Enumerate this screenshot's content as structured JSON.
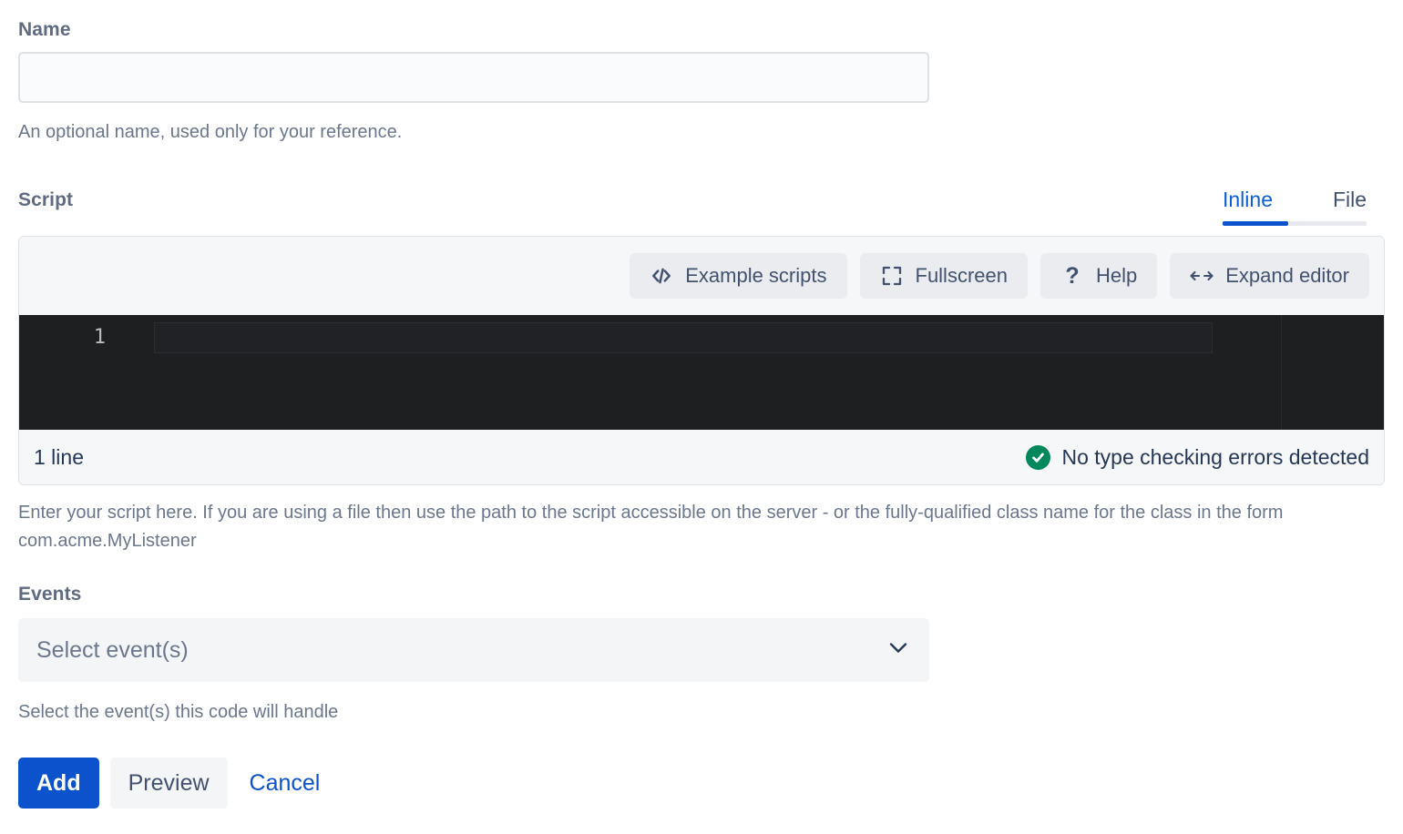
{
  "name_field": {
    "label": "Name",
    "value": "",
    "placeholder": "",
    "description": "An optional name, used only for your reference."
  },
  "script_section": {
    "label": "Script",
    "tabs": [
      {
        "label": "Inline",
        "active": true
      },
      {
        "label": "File",
        "active": false
      }
    ],
    "toolbar": [
      {
        "label": "Example scripts",
        "icon": "code-icon"
      },
      {
        "label": "Fullscreen",
        "icon": "fullscreen-icon"
      },
      {
        "label": "Help",
        "icon": "question-mark-icon"
      },
      {
        "label": "Expand editor",
        "icon": "left-right-arrow-icon"
      }
    ],
    "editor": {
      "line_numbers": [
        "1"
      ],
      "content": ""
    },
    "status": {
      "line_count": "1 line",
      "type_check": "No type checking errors detected",
      "type_check_icon": "check-circle-icon"
    },
    "description": "Enter your script here. If you are using a file then use the path to the script accessible on the server - or the fully-qualified class name for the class in the form com.acme.MyListener"
  },
  "events_section": {
    "label": "Events",
    "select_value": "Select event(s)",
    "select_icon": "chevron-down-icon",
    "description": "Select the event(s) this code will handle"
  },
  "actions": {
    "add_label": "Add",
    "preview_label": "Preview",
    "cancel_label": "Cancel"
  },
  "colors": {
    "primary_blue": "#0b52cc",
    "link_blue": "#0b52cc",
    "success_green": "#00875a",
    "editor_background": "#1e1f21",
    "panel_background": "#f6f7f9",
    "text": "#253858",
    "muted_text": "#6b778c"
  }
}
